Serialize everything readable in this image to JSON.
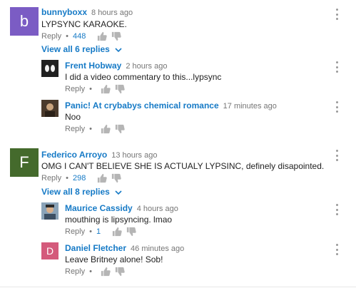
{
  "colors": {
    "link": "#167ac6",
    "meta": "#767676",
    "avatar_b": "#7b5cc4",
    "avatar_f": "#446a2c",
    "avatar_d": "#d45a7b"
  },
  "comments": [
    {
      "avatar_letter": "b",
      "author": "bunnyboxx",
      "time": "8 hours ago",
      "text": "LYPSYNC KARAOKE.",
      "reply": "Reply",
      "likes": "448",
      "view_replies": "View all 6 replies",
      "replies": [
        {
          "avatar": "photo",
          "author": "Frent Hobway",
          "time": "2 hours ago",
          "text": "I did a video commentary to this...lypsync",
          "reply": "Reply"
        },
        {
          "avatar": "photo",
          "author": "Panic! At crybabys chemical romance",
          "time": "17 minutes ago",
          "text": "Noo",
          "reply": "Reply"
        }
      ]
    },
    {
      "avatar_letter": "F",
      "author": "Federico Arroyo",
      "time": "13 hours ago",
      "text": "OMG I CAN'T BELIEVE SHE IS ACTUALY LYPSINC, definely disapointed.",
      "reply": "Reply",
      "likes": "298",
      "view_replies": "View all 8 replies",
      "replies": [
        {
          "avatar": "photo",
          "author": "Maurice Cassidy",
          "time": "4 hours ago",
          "text": "mouthing is lipsyncing. lmao",
          "reply": "Reply",
          "likes": "1"
        },
        {
          "avatar_letter": "D",
          "author": "Daniel Fletcher",
          "time": "46 minutes ago",
          "text": "Leave Britney alone! Sob!",
          "reply": "Reply"
        }
      ]
    }
  ]
}
